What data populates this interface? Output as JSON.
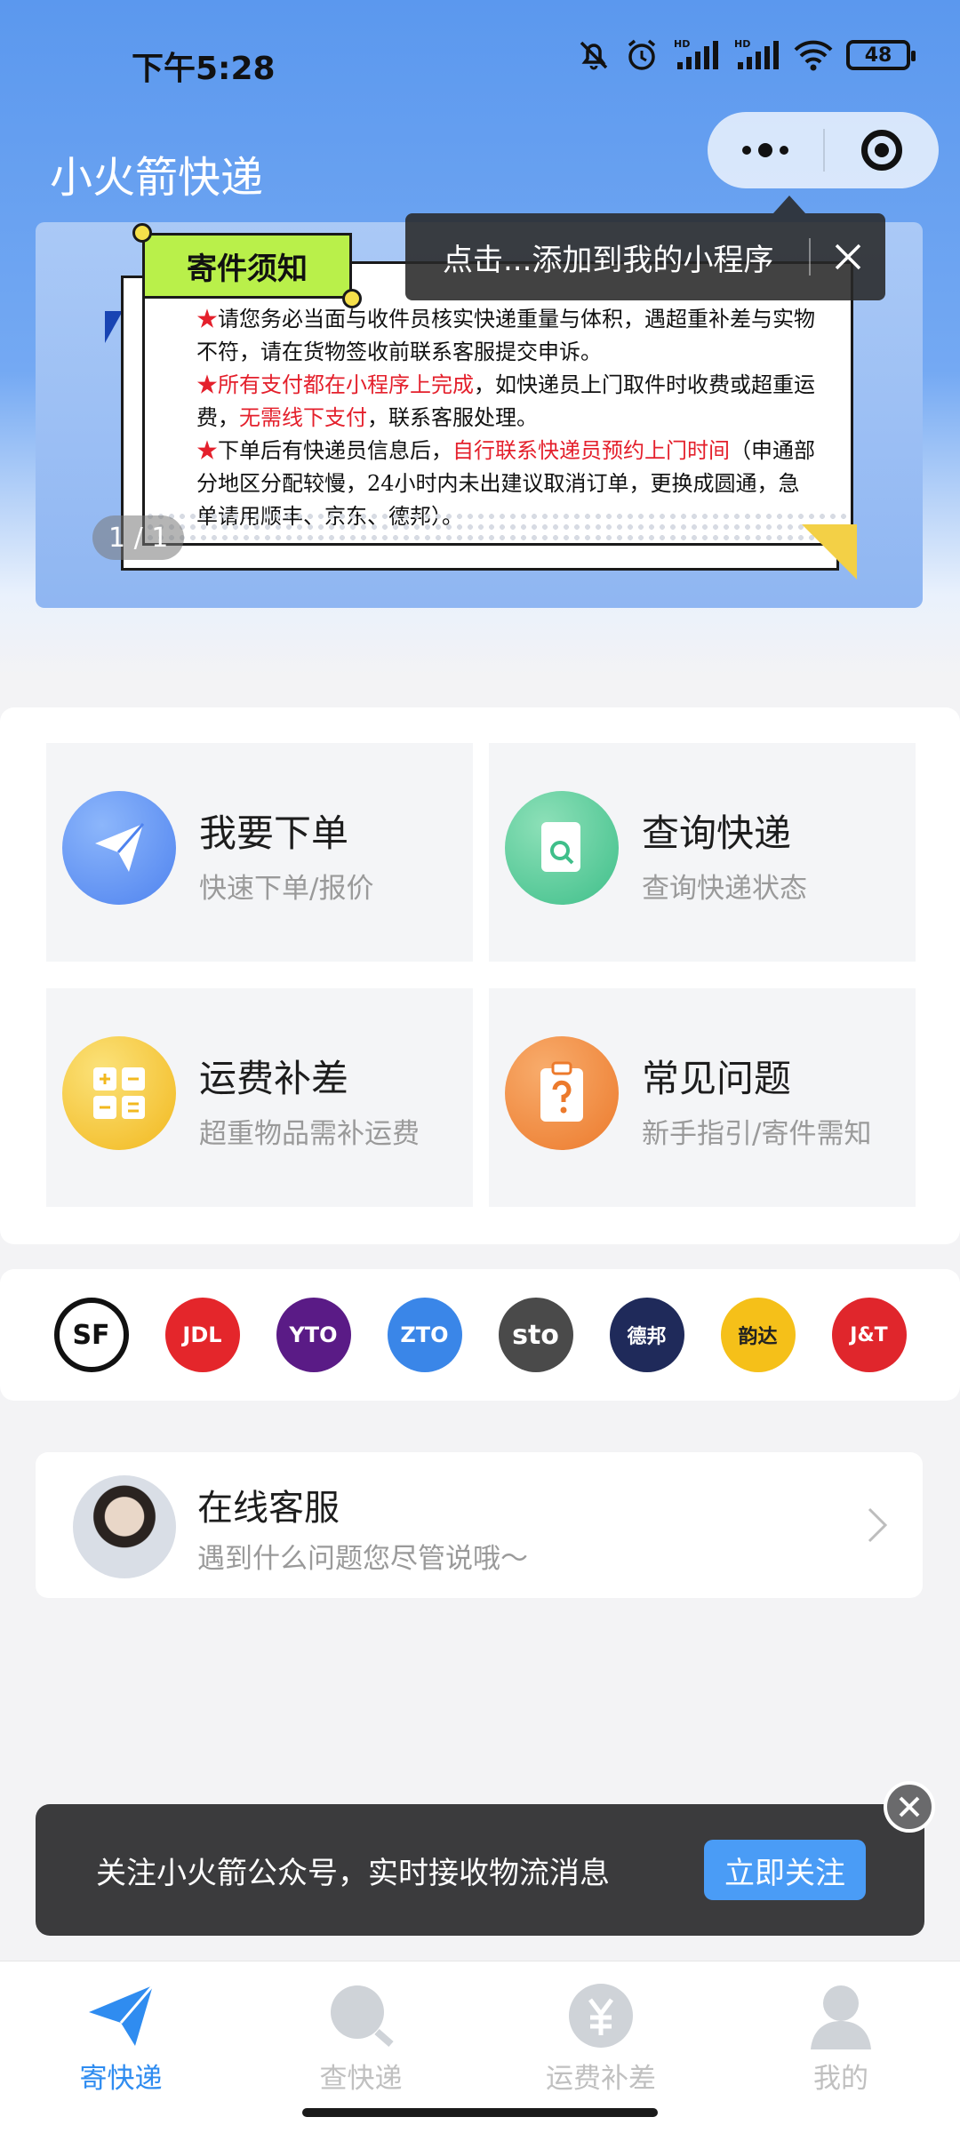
{
  "status_bar": {
    "time": "下午5:28",
    "battery": "48"
  },
  "header": {
    "title": "小火箭快递"
  },
  "tooltip": {
    "text": "点击...添加到我的小程序"
  },
  "banner": {
    "tag": "寄件须知",
    "line1": "请您务必当面与收件员核实快递重量与体积，遇超重补差与实物不符，请在货物签收前联系客服提交申诉。",
    "line2_red": "所有支付都在小程序上完成",
    "line2_black": "，如快递员上门取件时收费或超重运费，",
    "line2_red2": "无需线下支付",
    "line2_end": "，联系客服处理。",
    "line3_black": "下单后有快递员信息后，",
    "line3_red": "自行联系快递员预约上门时间",
    "line3_end": "（申通部分地区分配较慢，24小时内未出建议取消订单，更换成圆通，急单请用顺丰、京东、德邦）。",
    "pager": "1 / 1"
  },
  "tiles": [
    {
      "title": "我要下单",
      "sub": "快速下单/报价",
      "icon": "paper-plane-icon",
      "color": "#5b8ff2"
    },
    {
      "title": "查询快递",
      "sub": "查询快递状态",
      "icon": "search-doc-icon",
      "color": "#4fcb9a"
    },
    {
      "title": "运费补差",
      "sub": "超重物品需补运费",
      "icon": "calculator-icon",
      "color": "#f6c531"
    },
    {
      "title": "常见问题",
      "sub": "新手指引/寄件需知",
      "icon": "question-clipboard-icon",
      "color": "#f0843a"
    }
  ],
  "carriers": [
    {
      "name": "SF",
      "bg": "#ffffff",
      "fg": "#111111"
    },
    {
      "name": "JDL",
      "bg": "#e4262b",
      "fg": "#ffffff"
    },
    {
      "name": "YTO",
      "bg": "#5a1b86",
      "fg": "#ffffff"
    },
    {
      "name": "ZTO",
      "bg": "#3a86e8",
      "fg": "#ffffff"
    },
    {
      "name": "sto",
      "bg": "#4a4a4a",
      "fg": "#ffffff"
    },
    {
      "name": "德邦",
      "bg": "#1f2a5a",
      "fg": "#ffffff"
    },
    {
      "name": "韵达",
      "bg": "#f5c019",
      "fg": "#222222"
    },
    {
      "name": "J&T",
      "bg": "#e0262c",
      "fg": "#ffffff"
    }
  ],
  "service": {
    "title": "在线客服",
    "sub": "遇到什么问题您尽管说哦～"
  },
  "follow": {
    "text": "关注小火箭公众号，实时接收物流消息",
    "button": "立即关注"
  },
  "tabs": [
    {
      "label": "寄快递",
      "icon": "send-icon",
      "active": true
    },
    {
      "label": "查快递",
      "icon": "search-icon",
      "active": false
    },
    {
      "label": "运费补差",
      "icon": "yen-icon",
      "active": false
    },
    {
      "label": "我的",
      "icon": "user-icon",
      "active": false
    }
  ],
  "colors": {
    "accent": "#2f8cf0",
    "header_top": "#5b98ee",
    "warning_red": "#e4202c"
  }
}
